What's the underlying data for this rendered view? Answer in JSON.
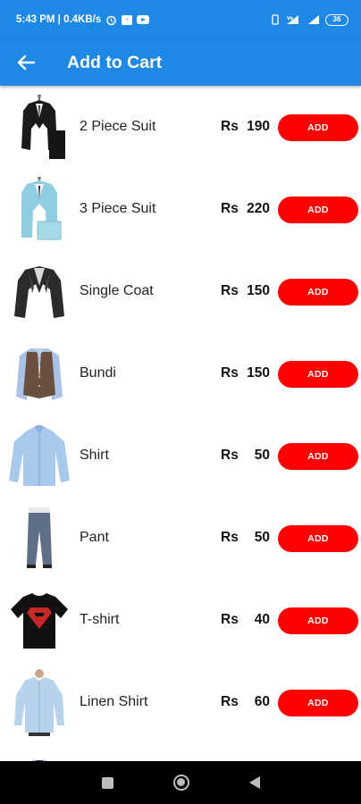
{
  "status_bar": {
    "time": "5:43 PM | 0.4KB/s",
    "battery": "36"
  },
  "app_bar": {
    "title": "Add to Cart",
    "back_icon": "arrow-back-icon"
  },
  "products": [
    {
      "name": "2 Piece Suit",
      "currency": "Rs",
      "price": "190",
      "button": "ADD",
      "icon": "two-piece-suit-image"
    },
    {
      "name": "3 Piece Suit",
      "currency": "Rs",
      "price": "220",
      "button": "ADD",
      "icon": "three-piece-suit-image"
    },
    {
      "name": "Single Coat",
      "currency": "Rs",
      "price": "150",
      "button": "ADD",
      "icon": "single-coat-image"
    },
    {
      "name": "Bundi",
      "currency": "Rs",
      "price": "150",
      "button": "ADD",
      "icon": "bundi-image"
    },
    {
      "name": "Shirt",
      "currency": "Rs",
      "price": "50",
      "button": "ADD",
      "icon": "shirt-image"
    },
    {
      "name": "Pant",
      "currency": "Rs",
      "price": "50",
      "button": "ADD",
      "icon": "pant-image"
    },
    {
      "name": "T-shirt",
      "currency": "Rs",
      "price": "40",
      "button": "ADD",
      "icon": "tshirt-image"
    },
    {
      "name": "Linen Shirt",
      "currency": "Rs",
      "price": "60",
      "button": "ADD",
      "icon": "linen-shirt-image"
    }
  ],
  "colors": {
    "primary": "#1e88e5",
    "add_button": "#ff0000",
    "nav_bar": "#000000"
  },
  "nav_bar": {
    "recents_icon": "square-icon",
    "home_icon": "circle-icon",
    "back_icon": "triangle-back-icon"
  }
}
